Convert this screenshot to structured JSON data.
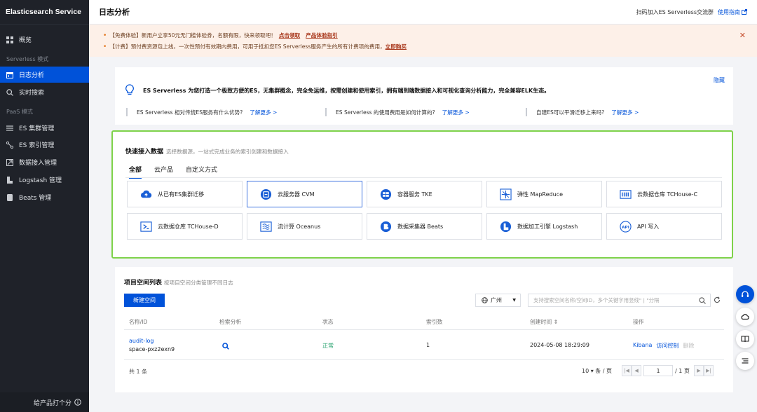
{
  "sidebar": {
    "title": "Elasticsearch Service",
    "items": [
      {
        "label": "概览"
      },
      {
        "label": "日志分析"
      },
      {
        "label": "实时搜索"
      },
      {
        "label": "ES 集群管理"
      },
      {
        "label": "ES 索引管理"
      },
      {
        "label": "数据接入管理"
      },
      {
        "label": "Logstash 管理"
      },
      {
        "label": "Beats 管理"
      }
    ],
    "sections": [
      "Serverless 模式",
      "PaaS 模式"
    ],
    "footer": "给产品打个分"
  },
  "header": {
    "title": "日志分析",
    "qr_text": "扫码加入ES Serverless交流群",
    "guide": "使用指南"
  },
  "notice": {
    "line1_text": "【免费体验】新用户立享50元无门槛体验券，名额有限，快来领取吧！",
    "line1_link1": "点击领取",
    "line1_link2": "产品体验指引",
    "line2_text": "【计费】预付费资源包上线，一次性预付有效期内费用，可用于抵扣您ES Serverless服务产生的所有计费项的费用，",
    "line2_link": "立即购买"
  },
  "intro": {
    "text": "ES Serverless 为您打造一个极致方便的ES，无集群概念，完全免运维，按需创建和使用索引，拥有端到端数据接入和可视化查询分析能力，完全兼容ELK生态。",
    "hide": "隐藏",
    "faqs": [
      {
        "q": "ES Serverless 相对传统ES服务有什么优势?",
        "link": "了解更多 >"
      },
      {
        "q": "ES Serverless 的使用费用是如何计算的?",
        "link": "了解更多 >"
      },
      {
        "q": "自建ES可以平滑迁移上来吗?",
        "link": "了解更多 >"
      }
    ]
  },
  "quick": {
    "title": "快速接入数据",
    "subtitle": "选择数据源，一站式完成业务的索引创建和数据接入",
    "tabs": [
      "全部",
      "云产品",
      "自定义方式"
    ],
    "tiles": [
      {
        "label": "从已有ES集群迁移",
        "icon": "cloud-upload-icon"
      },
      {
        "label": "云服务器 CVM",
        "icon": "cvm-icon"
      },
      {
        "label": "容器服务 TKE",
        "icon": "tke-icon"
      },
      {
        "label": "弹性 MapReduce",
        "icon": "emr-icon"
      },
      {
        "label": "云数据仓库 TCHouse-C",
        "icon": "tchouse-c-icon"
      },
      {
        "label": "云数据仓库 TCHouse-D",
        "icon": "tchouse-d-icon"
      },
      {
        "label": "流计算 Oceanus",
        "icon": "oceanus-icon"
      },
      {
        "label": "数据采集器 Beats",
        "icon": "beats-icon"
      },
      {
        "label": "数据加工引擎 Logstash",
        "icon": "logstash-icon"
      },
      {
        "label": "API 写入",
        "icon": "api-icon"
      }
    ]
  },
  "project": {
    "title": "项目空间列表",
    "subtitle": "按项目空间分类管理不同日志",
    "new_button": "新建空间",
    "region": "广州",
    "search_placeholder": "支持搜索空间名称/空间ID，多个关键字用竖线\" | \"分隔",
    "columns": [
      "名称/ID",
      "检索分析",
      "状态",
      "索引数",
      "创建时间 ⇕",
      "操作"
    ],
    "rows": [
      {
        "name": "audit-log",
        "id": "space-pxz2exn9",
        "status": "正常",
        "indices": "1",
        "created": "2024-05-08 18:29:09",
        "ops": [
          "Kibana",
          "访问控制",
          "删除"
        ]
      }
    ],
    "total": "共 1 条",
    "page_size": "10 ▾ 条 / 页",
    "page": "1",
    "page_total": "/ 1 页"
  },
  "colors": {
    "accent": "#0052d9",
    "sidebar_bg": "#1f2229",
    "success": "#2ba471",
    "highlight_border": "#7ed24a"
  }
}
